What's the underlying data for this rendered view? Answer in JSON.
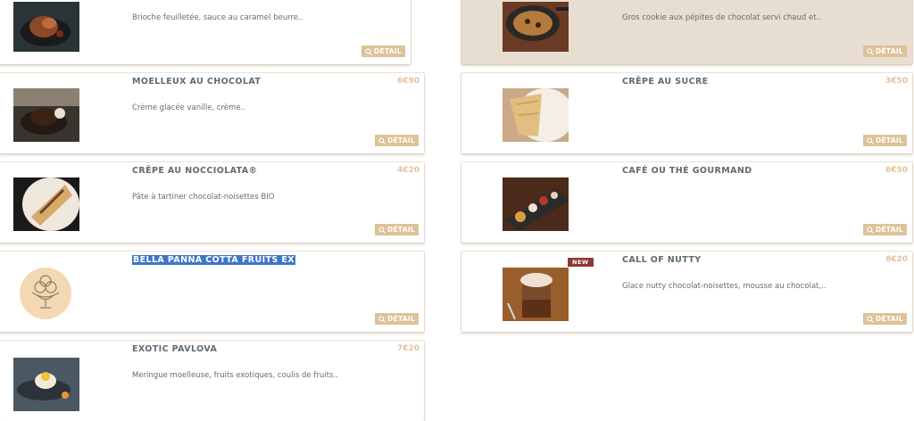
{
  "detail_label": "DÉTAIL",
  "colors": {
    "accent": "#dcc398",
    "price": "#e5c199",
    "badge": "#8a3b32",
    "selection": "#3e76c7"
  },
  "left": [
    {
      "title": "",
      "price": "",
      "desc": "Brioche feuilletée, sauce au caramel beurre..",
      "image": "brioche-photo"
    },
    {
      "title": "MOELLEUX AU CHOCOLAT",
      "price": "6€90",
      "desc": "Crème glacée vanille, crème..",
      "image": "chocolate-cake-photo"
    },
    {
      "title": "CRÊPE AU NOCCIOLATA®",
      "price": "4€20",
      "desc": "Pâte à tartiner chocolat-noisettes BIO",
      "image": "crepe-nocciolata-photo"
    },
    {
      "title": "BELLA PANNA COTTA FRUITS EX",
      "title_suffix": "..",
      "price": "",
      "desc": "",
      "image": "ice-cream-placeholder-icon"
    },
    {
      "title": "EXOTIC PAVLOVA",
      "price": "7€20",
      "desc": "Meringue moelleuse, fruits exotiques, coulis de fruits..",
      "image": "pavlova-photo"
    }
  ],
  "right": [
    {
      "title": "",
      "price": "",
      "desc": "Gros cookie aux pépites de chocolat servi chaud et..",
      "image": "cookie-pan-photo"
    },
    {
      "title": "CRÊPE AU SUCRE",
      "price": "3€50",
      "desc": "",
      "image": "crepe-sucre-photo"
    },
    {
      "title": "CAFÉ OU THÉ GOURMAND",
      "price": "6€50",
      "desc": "",
      "image": "cafe-gourmand-photo"
    },
    {
      "title": "CALL OF NUTTY",
      "price": "8€20",
      "desc": "Glace nutty chocolat-noisettes, mousse au chocolat,..",
      "badge": "NEW",
      "image": "nutty-glass-photo"
    }
  ]
}
